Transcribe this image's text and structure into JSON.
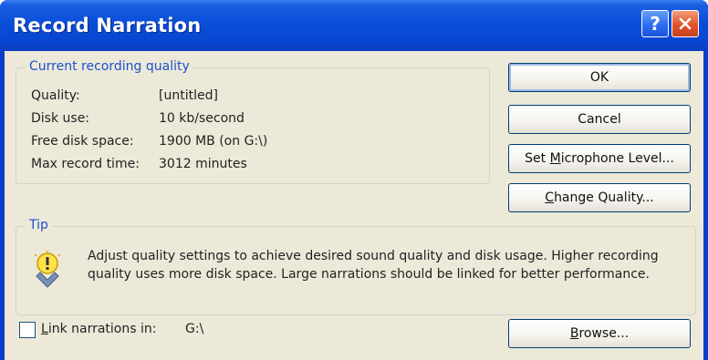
{
  "window": {
    "title": "Record Narration",
    "help_glyph": "?"
  },
  "quality_group": {
    "legend": "Current recording quality",
    "rows": [
      {
        "label": "Quality:",
        "value": "[untitled]"
      },
      {
        "label": "Disk use:",
        "value": "10 kb/second"
      },
      {
        "label": "Free disk space:",
        "value": "1900 MB (on G:\\)"
      },
      {
        "label": "Max record time:",
        "value": "3012 minutes"
      }
    ]
  },
  "buttons": {
    "ok": "OK",
    "cancel": "Cancel",
    "mic_prefix": "Set ",
    "mic_accel": "M",
    "mic_rest": "icrophone Level...",
    "quality_accel": "C",
    "quality_rest": "hange Quality...",
    "browse_accel": "B",
    "browse_rest": "rowse..."
  },
  "tip": {
    "legend": "Tip",
    "text": "Adjust quality settings to achieve desired sound quality and disk usage. Higher recording quality uses more disk space. Large narrations should be linked for better performance.",
    "icon": "lightbulb-icon"
  },
  "link": {
    "checked": false,
    "label_accel": "L",
    "label_rest": "ink narrations in:",
    "path": "G:\\"
  },
  "colors": {
    "titlebar": "#0a4dd8",
    "face": "#ece9d8",
    "legend_text": "#1f4fd0",
    "close": "#e2532a"
  }
}
